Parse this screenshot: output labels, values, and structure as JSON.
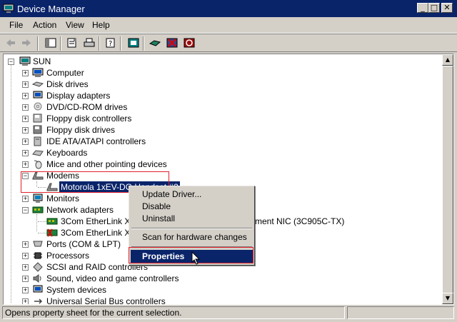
{
  "window": {
    "title": "Device Manager",
    "controls": {
      "minimize": "_",
      "maximize": "□",
      "close": "✕"
    }
  },
  "menu": [
    "File",
    "Action",
    "View",
    "Help"
  ],
  "toolbar": {
    "buttons": [
      "back-icon",
      "forward-icon",
      "console-tree-icon",
      "properties-icon",
      "print-icon",
      "help-icon",
      "scan-hardware-icon",
      "update-driver-icon",
      "uninstall-icon",
      "disable-icon"
    ]
  },
  "tree": {
    "root": "SUN",
    "items": [
      "Computer",
      "Disk drives",
      "Display adapters",
      "DVD/CD-ROM drives",
      "Floppy disk controllers",
      "Floppy disk drives",
      "IDE ATA/ATAPI controllers",
      "Keyboards",
      "Mice and other pointing devices",
      "Modems",
      "Motorola 1xEV-DO Handset #2",
      "Monitors",
      "Network adapters",
      "3Com EtherLink XL 1",
      "3Com EtherLink XL 1",
      "Ports (COM & LPT)",
      "Processors",
      "SCSI and RAID controllers",
      "Sound, video and game controllers",
      "System devices",
      "Universal Serial Bus controllers"
    ],
    "network_adapter_tail": "ment NIC (3C905C-TX)"
  },
  "context_menu": {
    "items": [
      "Update Driver...",
      "Disable",
      "Uninstall",
      "Scan for hardware changes",
      "Properties"
    ]
  },
  "statusbar": {
    "text": "Opens property sheet for the current selection."
  },
  "colors": {
    "selection": "#0a246a",
    "highlight_border": "#e0202a",
    "chrome": "#d4d0c8"
  }
}
